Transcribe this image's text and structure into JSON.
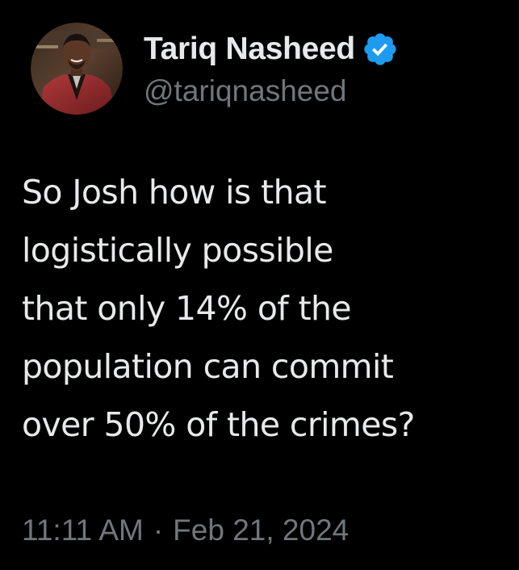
{
  "author": {
    "display_name": "Tariq Nasheed",
    "handle": "@tariqnasheed",
    "verified_icon": "verified-badge-icon",
    "verified_color": "#1d9bf0"
  },
  "tweet": {
    "lines": [
      "So Josh how is that",
      "logistically possible",
      "that only 14% of the",
      "population can commit",
      "over 50% of the crimes?"
    ]
  },
  "meta": {
    "time": "11:11 AM",
    "separator": "·",
    "date": "Feb 21, 2024"
  },
  "colors": {
    "background": "#000000",
    "text_primary": "#e7e9ea",
    "text_secondary": "#71767b"
  }
}
